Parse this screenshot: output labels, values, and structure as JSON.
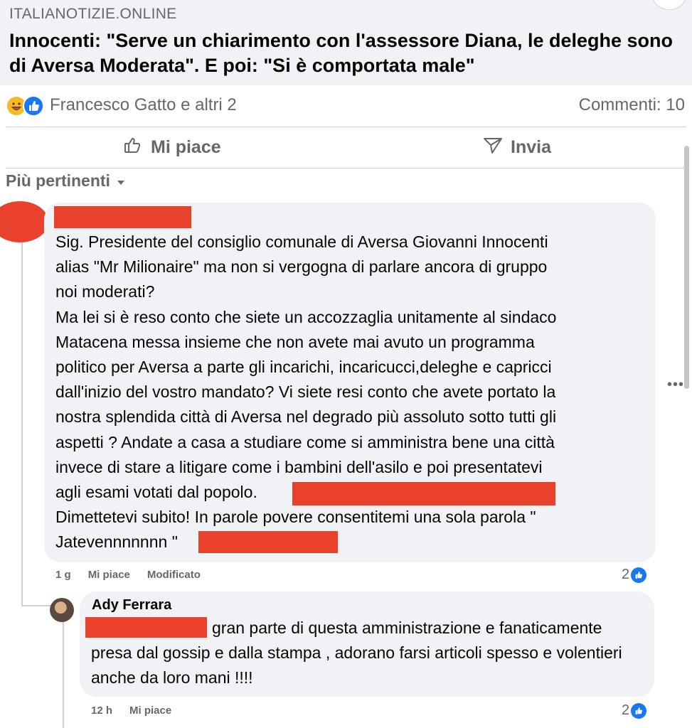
{
  "link_preview": {
    "domain": "ITALIANOTIZIE.ONLINE",
    "headline": "Innocenti: \"Serve un chiarimento con l'assessore Diana, le deleghe sono di Aversa Moderata\". E poi: \"Si è comportata male\""
  },
  "reactions": {
    "icons": [
      "haha-icon",
      "like-icon"
    ],
    "reactors": "Francesco Gatto e altri 2",
    "comments_count": "Commenti: 10"
  },
  "actions": {
    "like": "Mi piace",
    "share": "Invia"
  },
  "sort": {
    "label": "Più pertinenti"
  },
  "comments": [
    {
      "text_before": "Sig. Presidente del consiglio comunale di Aversa Giovanni Innocenti\nalias \"Mr Milionaire\" ma non si vergogna di parlare ancora di gruppo\nnoi moderati?\nMa lei si è reso conto che siete un accozzaglia unitamente al sindaco\nMatacena messa insieme che non avete mai avuto un programma\npolitico per Aversa a parte gli incarichi, incaricucci,deleghe e capricci\ndall'inizio del vostro mandato? Vi siete resi conto che avete portato la\nnostra splendida città di Aversa nel degrado più assoluto sotto tutti gli\naspetti ? Andate a casa a studiare come si amministra bene una città\ninvece di stare a litigare come i bambini dell'asilo e poi presentatevi\nagli esami votati dal popolo.\nDimettetevi subito! In parole povere consentitemi una sola parola \"\nJatevennnnnnn \"",
      "time": "1 g",
      "like": "Mi piace",
      "edited": "Modificato",
      "likes": "2"
    },
    {
      "author": "Ady Ferrara",
      "text": "gran parte di questa amministrazione e fanaticamente presa dal gossip e dalla stampa , adorano farsi articoli spesso e volentieri anche da loro mani !!!!",
      "time": "12 h",
      "like": "Mi piace",
      "likes": "2"
    }
  ],
  "colors": {
    "redaction": "#e8412c",
    "bubble": "#f0f2f5",
    "secondary_text": "#65676b",
    "like_blue": "#1877f2"
  }
}
